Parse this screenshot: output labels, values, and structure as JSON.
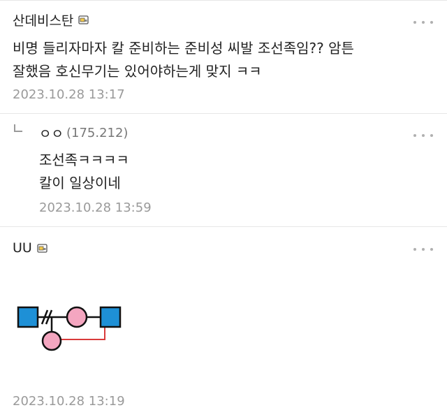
{
  "comments": [
    {
      "nickname": "산데비스탄",
      "body": "비명 들리자마자 칼 준비하는 준비성 씨발 조선족임?? 암튼\n잘했음 호신무기는 있어야하는게 맞지 ㅋㅋ",
      "date": "2023.10.28 13:17",
      "badge_icon": "member-badge-icon"
    },
    {
      "nickname": "ㅇㅇ",
      "ip": "(175.212)",
      "body": "조선족ㅋㅋㅋㅋ\n칼이 일상이네",
      "date": "2023.10.28 13:59",
      "reply_icon": "reply-arrow-icon"
    },
    {
      "nickname": "UU",
      "date": "2023.10.28 13:19",
      "badge_icon": "member-badge-icon",
      "image": "pedigree-diagram-dccon"
    }
  ],
  "colors": {
    "date": "#9a9a9a",
    "divider": "#e6e6e6",
    "pedigree_square": "#1e90d6",
    "pedigree_circle": "#f4a6c0",
    "pedigree_line": "#d93a3a"
  }
}
